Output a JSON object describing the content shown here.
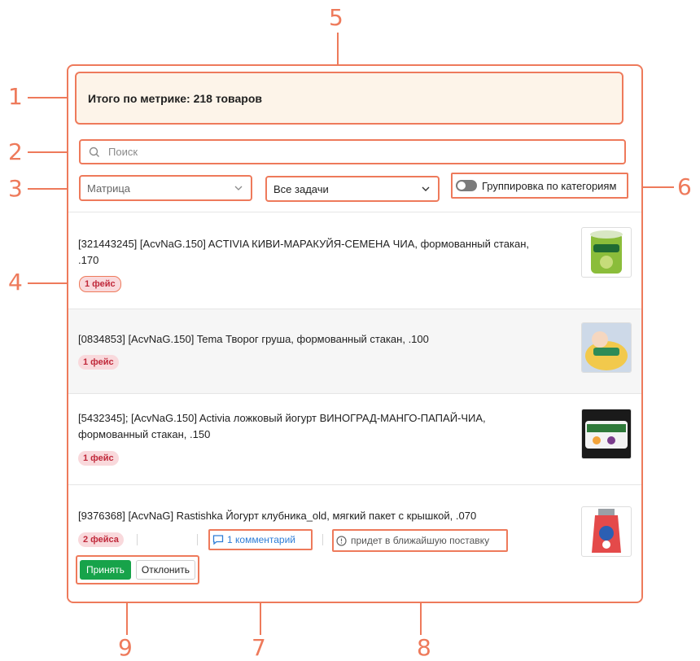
{
  "callouts": [
    "1",
    "2",
    "3",
    "4",
    "5",
    "6",
    "7",
    "8",
    "9"
  ],
  "summary": {
    "text": "Итого по метрике: 218 товаров"
  },
  "search": {
    "placeholder": "Поиск"
  },
  "filters": {
    "matrix": {
      "value": "Матрица"
    },
    "tasks": {
      "value": "Все задачи"
    },
    "grouping": {
      "label": "Группировка по категориям",
      "enabled": false
    }
  },
  "items": [
    {
      "title": "[321443245] [AcvNaG.150] ACTIVIA КИВИ-МАРАКУЙЯ-СЕМЕНА ЧИА, формованный стакан, .170",
      "badge": "1 фейс"
    },
    {
      "title": "[0834853] [AcvNaG.150]  Tema Творог груша, формованный стакан, .100",
      "badge": "1 фейс"
    },
    {
      "title": "[5432345]; [AcvNaG.150] Activia ложковый йогурт ВИНОГРАД-МАНГО-ПАПАЙ-ЧИА, формованный стакан, .150",
      "badge": "1 фейс"
    },
    {
      "title": "[9376368] [AcvNaG]  Rastishka Йогурт клубника_old, мягкий пакет с крышкой, .070",
      "badge": "2 фейса",
      "comment": "1 комментарий",
      "delivery": "придет в ближайшую поставку",
      "accept": "Принять",
      "reject": "Отклонить"
    }
  ],
  "colors": {
    "accent": "#ee7a5b",
    "badge_bg": "#f9d9dc",
    "badge_text": "#c0283a",
    "accept": "#17a34a",
    "link": "#2e7dd6"
  }
}
